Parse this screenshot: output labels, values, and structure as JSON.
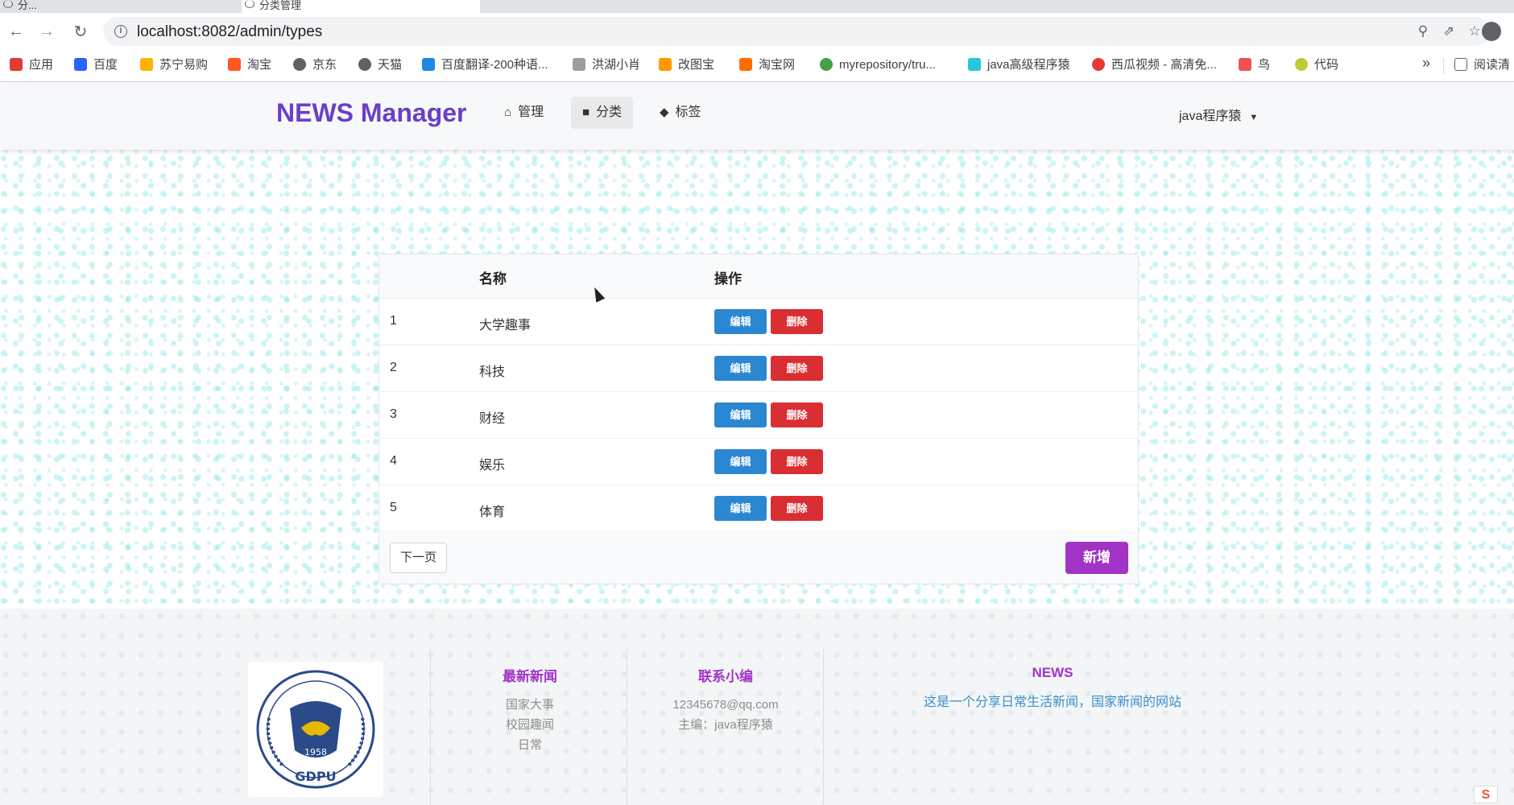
{
  "browser": {
    "tab_inactive_title": "分...",
    "tab_active_title": "分类管理",
    "url": "localhost:8082/admin/types",
    "bookmarks": [
      {
        "label": "应用",
        "color": "#e53935"
      },
      {
        "label": "百度",
        "color": "#2962ff"
      },
      {
        "label": "苏宁易购",
        "color": "#ffb300"
      },
      {
        "label": "淘宝",
        "color": "#ff5722"
      },
      {
        "label": "京东",
        "color": "#5f6368"
      },
      {
        "label": "天猫",
        "color": "#5f6368"
      },
      {
        "label": "百度翻译-200种语...",
        "color": "#1e88e5"
      },
      {
        "label": "洪湖小肖",
        "color": "#9e9e9e"
      },
      {
        "label": "改图宝",
        "color": "#ff9800"
      },
      {
        "label": "淘宝网",
        "color": "#ff6d00"
      },
      {
        "label": "myrepository/tru...",
        "color": "#43a047"
      },
      {
        "label": "java高级程序猿",
        "color": "#26c6da"
      },
      {
        "label": "西瓜视频 - 高清免...",
        "color": "#e53935"
      },
      {
        "label": "鸟",
        "color": "#ef5350"
      },
      {
        "label": "代码",
        "color": "#c0ca33"
      }
    ],
    "more_label": "»",
    "reading_list_label": "阅读清"
  },
  "nav": {
    "brand": "NEWS Manager",
    "items": [
      {
        "label": "管理",
        "icon": "home-icon"
      },
      {
        "label": "分类",
        "icon": "folder-icon"
      },
      {
        "label": "标签",
        "icon": "tags-icon"
      }
    ],
    "active_index": 1,
    "user": "java程序猿"
  },
  "table": {
    "headers": [
      "",
      "名称",
      "操作"
    ],
    "rows": [
      {
        "id": "1",
        "name": "大学趣事"
      },
      {
        "id": "2",
        "name": "科技"
      },
      {
        "id": "3",
        "name": "财经"
      },
      {
        "id": "4",
        "name": "娱乐"
      },
      {
        "id": "5",
        "name": "体育"
      }
    ],
    "edit_label": "编辑",
    "delete_label": "删除",
    "next_label": "下一页",
    "new_label": "新增"
  },
  "footer": {
    "col1": {
      "title": "最新新闻",
      "links": [
        "国家大事",
        "校园趣闻",
        "日常"
      ]
    },
    "col2": {
      "title": "联系小编",
      "lines": [
        "12345678@qq.com",
        "主编：java程序猿"
      ]
    },
    "col3": {
      "title": "NEWS",
      "desc": "这是一个分享日常生活新闻，国家新闻的网站"
    },
    "logo_text": "GDPU",
    "logo_year": "1958"
  },
  "colors": {
    "brand": "#6a3fc8",
    "accent_purple": "#a233c6",
    "edit_blue": "#2b87d1",
    "delete_red": "#d92e32"
  }
}
